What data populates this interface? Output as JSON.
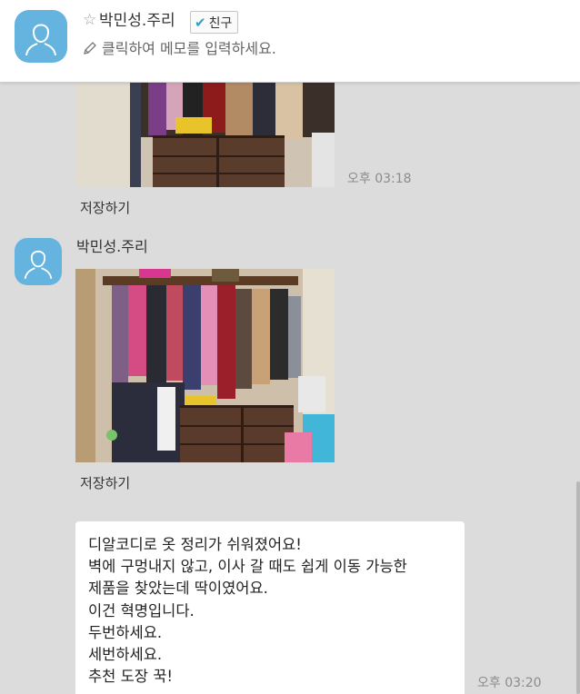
{
  "header": {
    "name": "박민성.주리",
    "friend_label": "친구",
    "memo_placeholder": "클릭하여 메모를 입력하세요."
  },
  "messages": {
    "first": {
      "time": "오후 03:18",
      "save_label": "저장하기"
    },
    "second": {
      "sender": "박민성.주리",
      "save_label": "저장하기"
    },
    "third": {
      "time": "오후 03:20",
      "lines": [
        "디알코디로 옷 정리가 쉬워졌어요!",
        "벽에 구멍내지 않고, 이사 갈 때도 쉽게 이동 가능한",
        "제품을 찾았는데 딱이였어요.",
        "이건 혁명입니다.",
        "두번하세요.",
        "세번하세요.",
        "추천 도장 꾹!"
      ]
    }
  },
  "icons": {
    "star": "star-outline-icon",
    "check": "check-icon",
    "pencil": "pencil-icon",
    "avatar": "default-profile-avatar"
  },
  "colors": {
    "accent": "#65b4df",
    "background": "#dcdcdc",
    "check": "#2aa3c9"
  }
}
